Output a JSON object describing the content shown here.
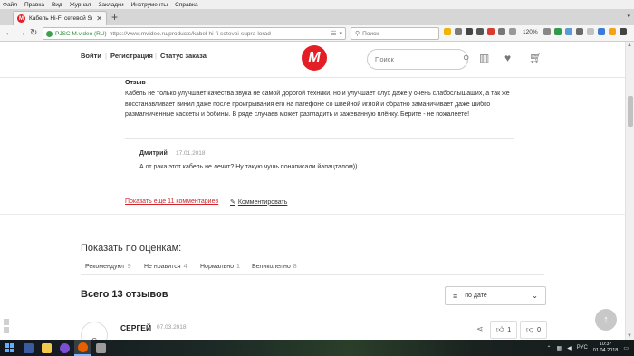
{
  "browser": {
    "menu": [
      "Файл",
      "Правка",
      "Вид",
      "Журнал",
      "Закладки",
      "Инструменты",
      "Справка"
    ],
    "tab_title": "Кабель Hi-Fi сетевой Supra Lo",
    "favicon_letter": "М",
    "url_company": "PJSC M.video (RU)",
    "url": "https://www.mvideo.ru/products/kabel-hi-fi-setevoi-supra-lorad-",
    "search_placeholder": "Поиск",
    "zoom": "120%"
  },
  "header": {
    "login": "Войти",
    "register": "Регистрация",
    "order_status": "Статус заказа",
    "logo_letter": "М",
    "search_placeholder": "Поиск"
  },
  "review": {
    "label": "Отзыв",
    "text": "Кабель не только улучшает качества звука не самой дорогой техники, но и улучшает слух даже у очень слабослышащих, а так же восстанавливает винил даже после проигрывания его на патефоне со швейной иглой и обратно заманичивает даже шибко размагниченные кассеты и бобины. В ряде случаев может разгладить и зажеванную плёнку. Берите - не пожалеете!",
    "reply": {
      "author": "Дмитрий",
      "date": "17.01.2018",
      "text": "А от рака этот кабель не лечит? Ну такую чушь понаписали йапацталом))"
    },
    "more_comments": "Показать еще 11 комментариев",
    "comment_action": "Комментировать"
  },
  "ratings": {
    "title": "Показать по оценкам:",
    "filters": [
      {
        "label": "Рекомендуют",
        "count": "9"
      },
      {
        "label": "Не нравится",
        "count": "4"
      },
      {
        "label": "Нормально",
        "count": "1"
      },
      {
        "label": "Великолепно",
        "count": "8"
      }
    ]
  },
  "reviews_list": {
    "total": "Всего 13 отзывов",
    "sort_value": "по дате",
    "first": {
      "avatar_letter": "С",
      "author": "СЕРГЕЙ",
      "date": "07.03.2018",
      "likes": "1",
      "dislikes": "0"
    }
  },
  "taskbar": {
    "lang": "РУС",
    "time": "10:37",
    "date": "01.04.2018"
  }
}
